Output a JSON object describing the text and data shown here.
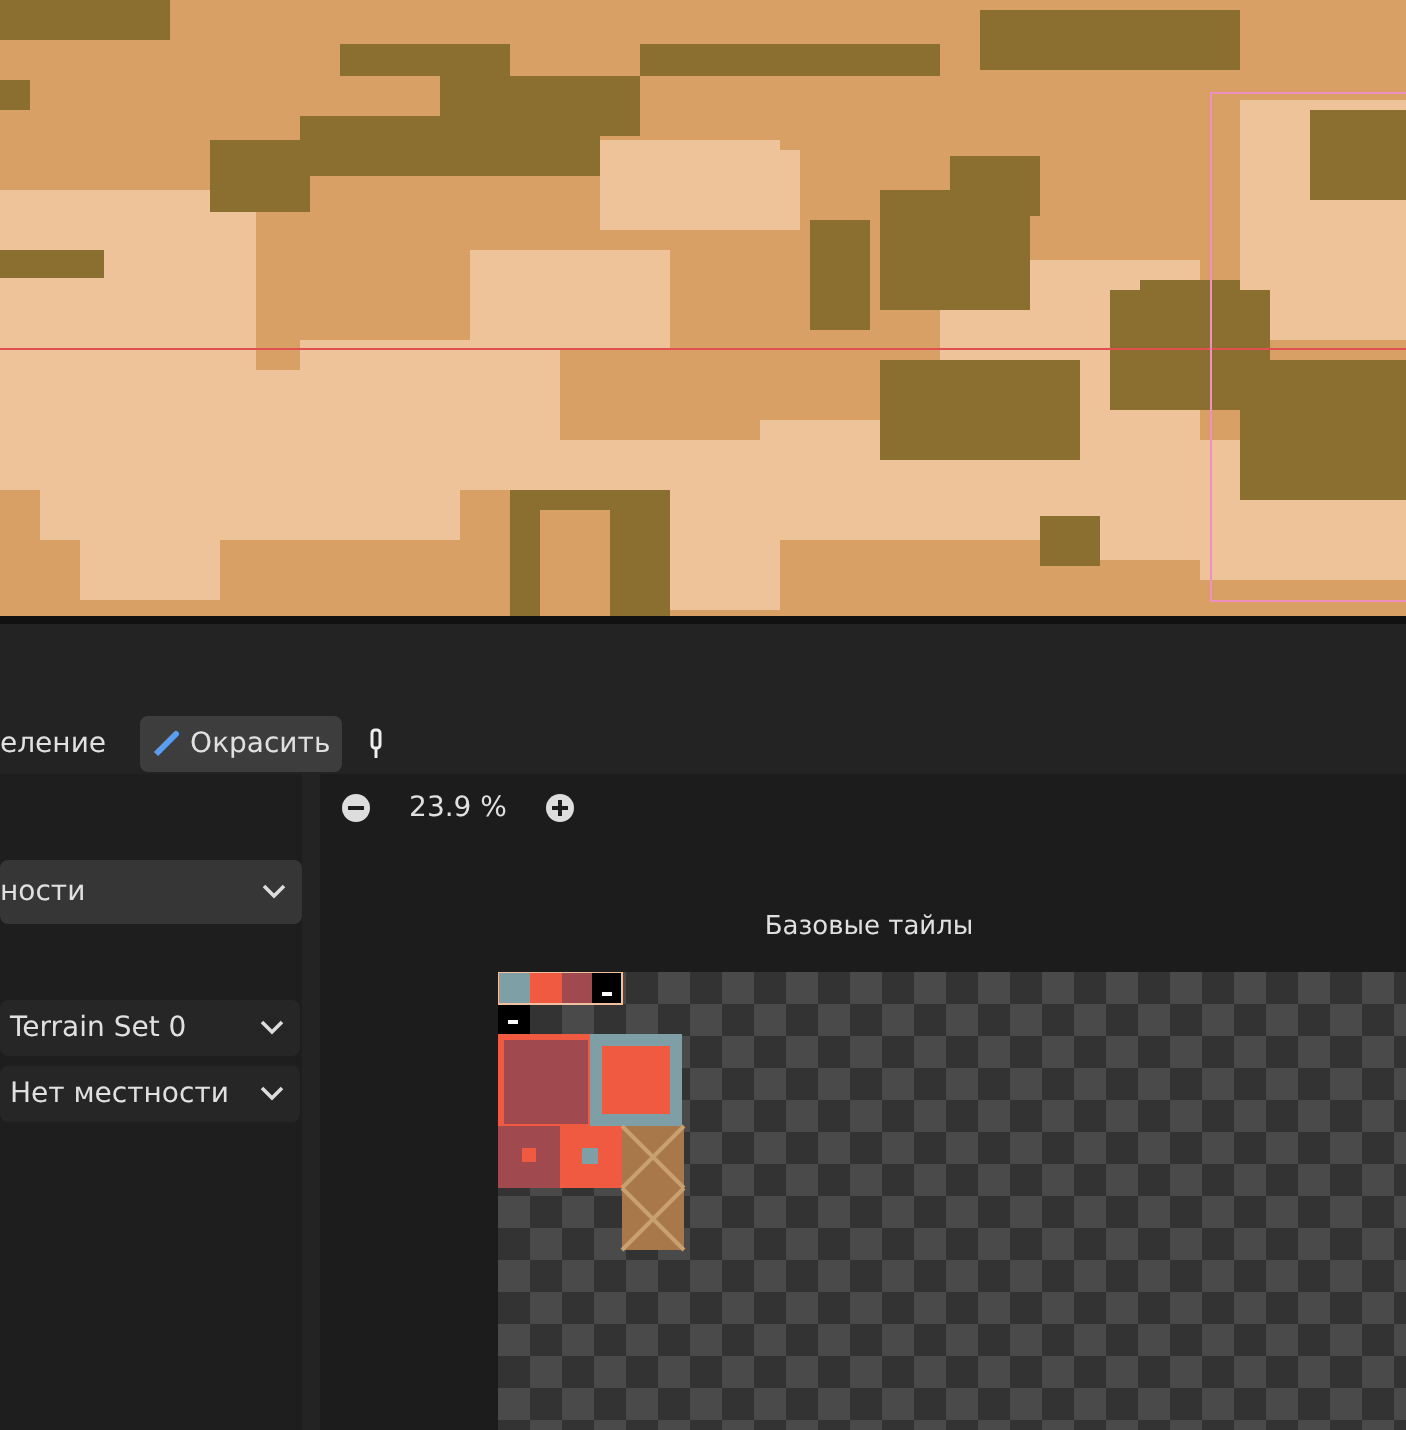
{
  "toolbar": {
    "tools": [
      {
        "kind": "text",
        "label": "еление",
        "selected": false
      },
      {
        "kind": "paint",
        "label": "Окрасить",
        "selected": true
      },
      {
        "kind": "picker",
        "selected": false
      }
    ]
  },
  "left_panel": {
    "mode_dropdown": "ности",
    "terrain_set_dropdown": "Terrain Set 0",
    "terrain_dropdown": "Нет местности"
  },
  "atlas_view": {
    "zoom": "23.9 %",
    "title": "Базовые тайлы"
  }
}
